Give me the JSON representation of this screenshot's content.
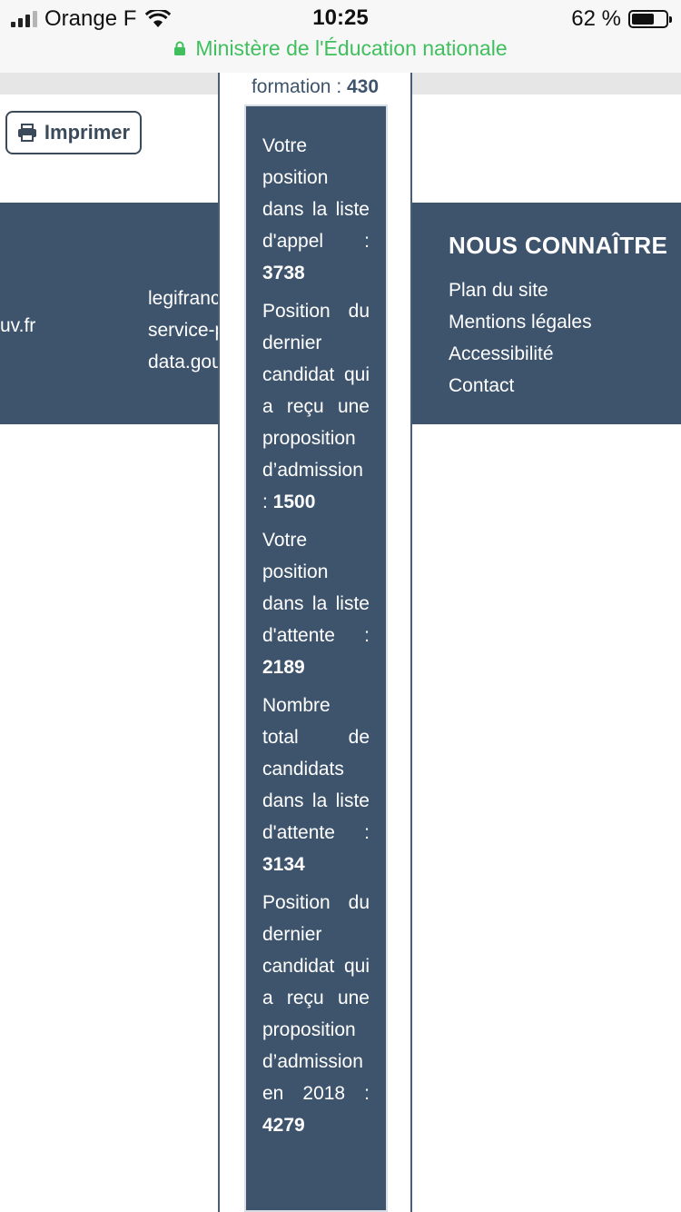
{
  "status_bar": {
    "carrier": "Orange F",
    "time": "10:25",
    "battery": "62 %",
    "url": "Ministère de l'Éducation nationale"
  },
  "toolbar": {
    "print_label": "Imprimer"
  },
  "footer": {
    "link_gouv": "uv.fr",
    "links_col2": [
      "legifrance.gouv.fr",
      "service-public.fr",
      "data.gouv.fr"
    ],
    "nous_connaitre": {
      "title": "NOUS CONNAÎTRE",
      "items": [
        "Plan du site",
        "Mentions légales",
        "Accessibilité",
        "Contact"
      ]
    }
  },
  "overlay": {
    "formation_label": "formation : ",
    "formation_value": "430",
    "stats": [
      {
        "label": "Votre position dans la liste d'appel : ",
        "value": "3738"
      },
      {
        "label": "Position du dernier candidat qui a reçu une proposition d’admission : ",
        "value": "1500"
      },
      {
        "label": "Votre position dans la liste d'attente : ",
        "value": "2189"
      },
      {
        "label": "Nombre total de candidats dans la liste d'attente : ",
        "value": "3134"
      },
      {
        "label": "Position du dernier candidat qui a reçu une proposition d’admission en 2018 : ",
        "value": "4279"
      }
    ]
  }
}
